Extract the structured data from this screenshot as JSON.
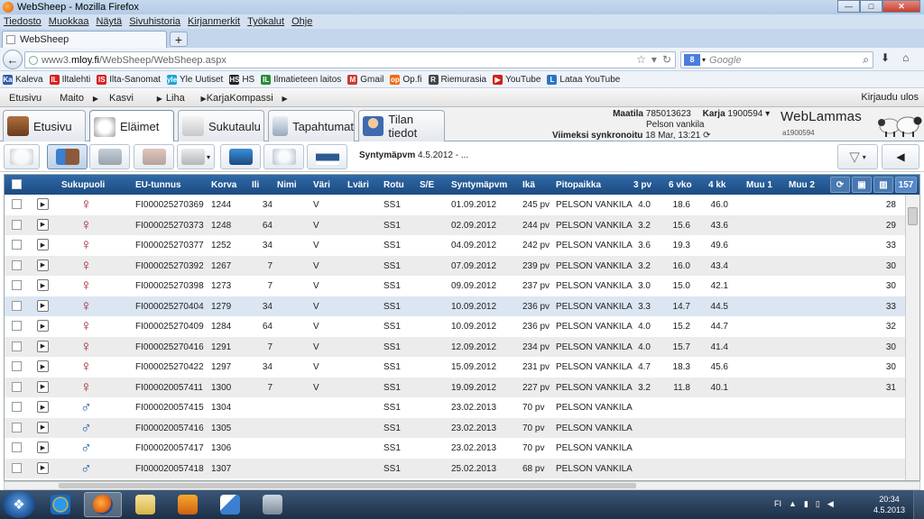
{
  "window": {
    "title": "WebSheep - Mozilla Firefox",
    "min": "—",
    "max": "□",
    "close": "✕"
  },
  "menu": [
    "Tiedosto",
    "Muokkaa",
    "Näytä",
    "Sivuhistoria",
    "Kirjanmerkit",
    "Työkalut",
    "Ohje"
  ],
  "tab": {
    "label": "WebSheep",
    "new": "+"
  },
  "nav": {
    "url_prefix": "www3.",
    "url_domain": "mloy.fi",
    "url_path": "/WebSheep/WebSheep.aspx",
    "search_engine": "8",
    "search_placeholder": "Google"
  },
  "bookmarks": [
    {
      "label": "Kaleva",
      "icon": "Ka",
      "color": "#2b5ca8"
    },
    {
      "label": "Iltalehti",
      "icon": "IL",
      "color": "#d82020"
    },
    {
      "label": "Ilta-Sanomat",
      "icon": "IS",
      "color": "#d82020"
    },
    {
      "label": "Yle Uutiset",
      "icon": "yle",
      "color": "#1aa3d8"
    },
    {
      "label": "HS",
      "icon": "HS",
      "color": "#222222"
    },
    {
      "label": "Ilmatieteen laitos",
      "icon": "IL",
      "color": "#2a8b3a"
    },
    {
      "label": "Gmail",
      "icon": "M",
      "color": "#cc3b2e"
    },
    {
      "label": "Op.fi",
      "icon": "op",
      "color": "#f06a10"
    },
    {
      "label": "Riemurasia",
      "icon": "R",
      "color": "#444444"
    },
    {
      "label": "YouTube",
      "icon": "▶",
      "color": "#d0201a"
    },
    {
      "label": "Lataa YouTube",
      "icon": "L",
      "color": "#2a74c8"
    }
  ],
  "appmenu": {
    "items": [
      "Etusivu",
      "Maito",
      "Kasvi",
      "Liha",
      "KarjaKompassi"
    ],
    "login": "Kirjaudu ulos"
  },
  "apptabs": [
    "Etusivu",
    "Eläimet",
    "Sukutaulu",
    "Tapahtumat",
    "Tilan tiedot"
  ],
  "farm": {
    "maatila_label": "Maatila",
    "maatila": "785013623",
    "karja_label": "Karja",
    "karja": "1900594",
    "farm_name": "Pelson vankila",
    "sync_label": "Viimeksi synkronoitu",
    "sync": "18 Mar, 13:21",
    "brand": "WebLammas",
    "brand_id": "a1900594"
  },
  "toolbar": {
    "filter_label": "Syntymäpvm",
    "filter_value": "4.5.2012 - ..."
  },
  "grid": {
    "columns": [
      "Sukupuoli",
      "EU-tunnus",
      "Korva",
      "Ili",
      "Nimi",
      "Väri",
      "Lväri",
      "Rotu",
      "S/E",
      "Syntymäpvm",
      "Ikä",
      "Pitopaikka",
      "3 pv",
      "6 vko",
      "4 kk",
      "Muu 1",
      "Muu 2"
    ],
    "count": "157",
    "rows": [
      {
        "sex": "f",
        "eu": "FI000025270369",
        "korva": "1244",
        "ili": "34",
        "vari": "V",
        "rotu": "SS1",
        "synt": "01.09.2012",
        "ika": "245 pv",
        "pito": "PELSON VANKILA",
        "d3": "4.0",
        "w6": "18.6",
        "k4": "46.0",
        "muu": "28"
      },
      {
        "sex": "f",
        "eu": "FI000025270373",
        "korva": "1248",
        "ili": "64",
        "vari": "V",
        "rotu": "SS1",
        "synt": "02.09.2012",
        "ika": "244 pv",
        "pito": "PELSON VANKILA",
        "d3": "3.2",
        "w6": "15.6",
        "k4": "43.6",
        "muu": "29"
      },
      {
        "sex": "f",
        "eu": "FI000025270377",
        "korva": "1252",
        "ili": "34",
        "vari": "V",
        "rotu": "SS1",
        "synt": "04.09.2012",
        "ika": "242 pv",
        "pito": "PELSON VANKILA",
        "d3": "3.6",
        "w6": "19.3",
        "k4": "49.6",
        "muu": "33"
      },
      {
        "sex": "f",
        "eu": "FI000025270392",
        "korva": "1267",
        "ili": "7",
        "vari": "V",
        "rotu": "SS1",
        "synt": "07.09.2012",
        "ika": "239 pv",
        "pito": "PELSON VANKILA",
        "d3": "3.2",
        "w6": "16.0",
        "k4": "43.4",
        "muu": "30"
      },
      {
        "sex": "f",
        "eu": "FI000025270398",
        "korva": "1273",
        "ili": "7",
        "vari": "V",
        "rotu": "SS1",
        "synt": "09.09.2012",
        "ika": "237 pv",
        "pito": "PELSON VANKILA",
        "d3": "3.0",
        "w6": "15.0",
        "k4": "42.1",
        "muu": "30"
      },
      {
        "sex": "f",
        "eu": "FI000025270404",
        "korva": "1279",
        "ili": "34",
        "vari": "V",
        "rotu": "SS1",
        "synt": "10.09.2012",
        "ika": "236 pv",
        "pito": "PELSON VANKILA",
        "d3": "3.3",
        "w6": "14.7",
        "k4": "44.5",
        "muu": "33"
      },
      {
        "sex": "f",
        "eu": "FI000025270409",
        "korva": "1284",
        "ili": "64",
        "vari": "V",
        "rotu": "SS1",
        "synt": "10.09.2012",
        "ika": "236 pv",
        "pito": "PELSON VANKILA",
        "d3": "4.0",
        "w6": "15.2",
        "k4": "44.7",
        "muu": "32"
      },
      {
        "sex": "f",
        "eu": "FI000025270416",
        "korva": "1291",
        "ili": "7",
        "vari": "V",
        "rotu": "SS1",
        "synt": "12.09.2012",
        "ika": "234 pv",
        "pito": "PELSON VANKILA",
        "d3": "4.0",
        "w6": "15.7",
        "k4": "41.4",
        "muu": "30"
      },
      {
        "sex": "f",
        "eu": "FI000025270422",
        "korva": "1297",
        "ili": "34",
        "vari": "V",
        "rotu": "SS1",
        "synt": "15.09.2012",
        "ika": "231 pv",
        "pito": "PELSON VANKILA",
        "d3": "4.7",
        "w6": "18.3",
        "k4": "45.6",
        "muu": "30"
      },
      {
        "sex": "f",
        "eu": "FI000020057411",
        "korva": "1300",
        "ili": "7",
        "vari": "V",
        "rotu": "SS1",
        "synt": "19.09.2012",
        "ika": "227 pv",
        "pito": "PELSON VANKILA",
        "d3": "3.2",
        "w6": "11.8",
        "k4": "40.1",
        "muu": "31"
      },
      {
        "sex": "m",
        "eu": "FI000020057415",
        "korva": "1304",
        "ili": "",
        "vari": "",
        "rotu": "SS1",
        "synt": "23.02.2013",
        "ika": "70 pv",
        "pito": "PELSON VANKILA",
        "d3": "",
        "w6": "",
        "k4": "",
        "muu": ""
      },
      {
        "sex": "m",
        "eu": "FI000020057416",
        "korva": "1305",
        "ili": "",
        "vari": "",
        "rotu": "SS1",
        "synt": "23.02.2013",
        "ika": "70 pv",
        "pito": "PELSON VANKILA",
        "d3": "",
        "w6": "",
        "k4": "",
        "muu": ""
      },
      {
        "sex": "m",
        "eu": "FI000020057417",
        "korva": "1306",
        "ili": "",
        "vari": "",
        "rotu": "SS1",
        "synt": "23.02.2013",
        "ika": "70 pv",
        "pito": "PELSON VANKILA",
        "d3": "",
        "w6": "",
        "k4": "",
        "muu": ""
      },
      {
        "sex": "m",
        "eu": "FI000020057418",
        "korva": "1307",
        "ili": "",
        "vari": "",
        "rotu": "SS1",
        "synt": "25.02.2013",
        "ika": "68 pv",
        "pito": "PELSON VANKILA",
        "d3": "",
        "w6": "",
        "k4": "",
        "muu": ""
      }
    ]
  },
  "taskbar": {
    "lang": "FI",
    "time": "20:34",
    "date": "4.5.2013"
  },
  "colors": {
    "header": "#1c4a80",
    "female": "#a0202a",
    "male": "#1c5da8"
  }
}
